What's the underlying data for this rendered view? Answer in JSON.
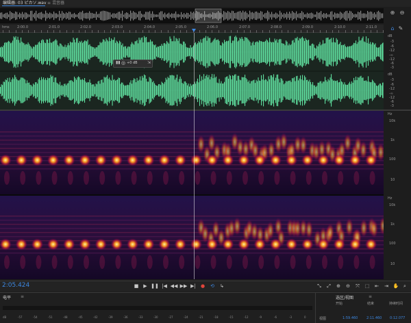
{
  "tabs": {
    "editor_label": "编辑器: 03 ピカソ.wav",
    "close_glyph": "≡",
    "mixer_label": "混音器"
  },
  "ruler": {
    "unit": "hms",
    "labels": [
      "2:00.0",
      "2:01.0",
      "2:02.0",
      "2:03.0",
      "2:04.0",
      "2:05.0",
      "2:06.0",
      "2:07.0",
      "2:08.0",
      "2:09.0",
      "2:10.0",
      "2:11.0"
    ]
  },
  "waveform": {
    "scale_unit": "dB",
    "scale_labels": [
      "-3",
      "-6",
      "-12",
      "-∞",
      "-12",
      "-6",
      "-3"
    ],
    "channel2_unit": "dB",
    "channel2_labels": [
      "-3",
      "-6",
      "-12",
      "-∞",
      "-12",
      "-6",
      "-3"
    ],
    "color": "#5fe0a0"
  },
  "hud": {
    "volume": "+0 dB"
  },
  "spectral": {
    "unit": "Hz",
    "labels": [
      "10k",
      "1k",
      "100",
      "10"
    ]
  },
  "transport": {
    "timecode": "2:05.424",
    "accent": "#3d87e0"
  },
  "levels": {
    "title": "电平",
    "menu": "≡",
    "scale": [
      "dB",
      "-57",
      "-54",
      "-51",
      "-48",
      "-45",
      "-42",
      "-39",
      "-36",
      "-33",
      "-30",
      "-27",
      "-24",
      "-21",
      "-18",
      "-15",
      "-12",
      "-9",
      "-6",
      "-3",
      "0"
    ]
  },
  "selection_view": {
    "title": "选区/视图",
    "menu": "≡",
    "headers": [
      "开始",
      "结束",
      "持续时间"
    ],
    "row_label": "视图",
    "values": [
      "1:59.460",
      "2:11.460",
      "0:12.077"
    ]
  }
}
